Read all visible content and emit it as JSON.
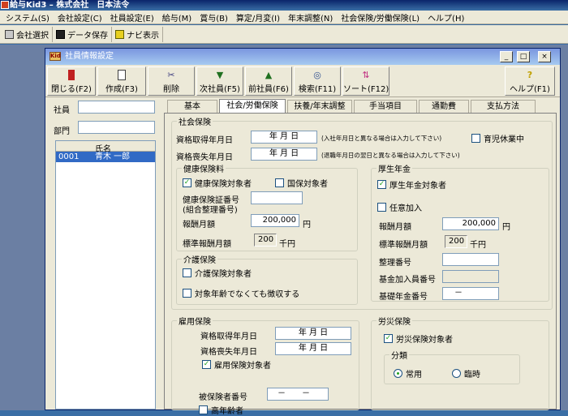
{
  "app": {
    "title": "給与Kid3 – 株式会社　日本法令",
    "menu": [
      "システム(S)",
      "会社設定(C)",
      "社員設定(E)",
      "給与(M)",
      "賞与(B)",
      "算定/月変(I)",
      "年末調整(N)",
      "社会保険/労働保険(L)",
      "ヘルプ(H)"
    ],
    "toolbar": [
      "会社選択",
      "データ保存",
      "ナビ表示"
    ]
  },
  "window": {
    "title": "社員情報設定",
    "icon_text": "Kid",
    "controls": [
      "_",
      "□",
      "×"
    ],
    "buttons": [
      "閉じる(F2)",
      "作成(F3)",
      "削除",
      "次社員(F5)",
      "前社員(F6)",
      "検索(F11)",
      "ソート(F12)",
      "ヘルプ(F1)"
    ]
  },
  "left": {
    "employee_label": "社員",
    "dept_label": "部門",
    "col_name": "氏名",
    "rows": [
      {
        "code": "0001",
        "name": "青木 一郎"
      }
    ]
  },
  "tabs": [
    "基本",
    "社会/労働保険",
    "扶養/年末調整",
    "手当項目",
    "通勤費",
    "支払方法"
  ],
  "social": {
    "legend": "社会保険",
    "acquire_label": "資格取得年月日",
    "acquire_value": "年 月 日",
    "acquire_note": "(入社年月日と異なる場合は入力して下さい)",
    "childcare_label": "育児休業中",
    "loss_label": "資格喪失年月日",
    "loss_value": "年 月 日",
    "loss_note": "(退職年月日の翌日と異なる場合は入力して下さい)"
  },
  "health": {
    "legend": "健康保険料",
    "covered_label": "健康保険対象者",
    "national_label": "国保対象者",
    "card_label": "健康保険証番号",
    "card_sub": "(組合整理番号)",
    "pay_label": "報酬月額",
    "pay_value": "200,000",
    "yen": "円",
    "std_label": "標準報酬月額",
    "std_value": "200",
    "thousand_yen": "千円"
  },
  "care": {
    "legend": "介護保険",
    "covered_label": "介護保険対象者",
    "collect_label": "対象年齢でなくても徴収する"
  },
  "pension": {
    "legend": "厚生年金",
    "covered_label": "厚生年金対象者",
    "voluntary_label": "任意加入",
    "pay_label": "報酬月額",
    "pay_value": "200,000",
    "yen": "円",
    "std_label": "標準報酬月額",
    "std_value": "200",
    "thousand_yen": "千円",
    "ref_label": "整理番号",
    "fund_label": "基金加入員番号",
    "basic_label": "基礎年金番号",
    "basic_value": "－"
  },
  "employment": {
    "legend": "雇用保険",
    "acquire_label": "資格取得年月日",
    "acquire_value": "年 月 日",
    "loss_label": "資格喪失年月日",
    "loss_value": "年 月 日",
    "covered_label": "雇用保険対象者",
    "insured_label": "被保険者番号",
    "insured_value": "－　　－",
    "senior_label": "高年齢者"
  },
  "workers": {
    "legend": "労災保険",
    "covered_label": "労災保険対象者",
    "class_legend": "分類",
    "regular_label": "常用",
    "temp_label": "臨時"
  }
}
